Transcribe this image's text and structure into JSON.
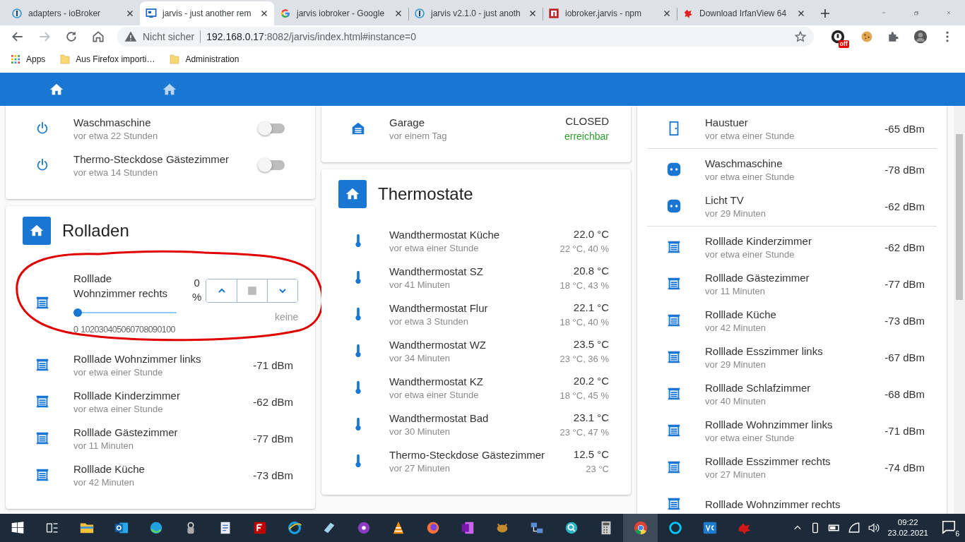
{
  "browser": {
    "tabs": [
      {
        "title": "adapters - ioBroker",
        "kind": "iobroker",
        "selected": false
      },
      {
        "title": "jarvis - just another rem",
        "kind": "jarvis",
        "selected": true
      },
      {
        "title": "jarvis iobroker - Google",
        "kind": "google",
        "selected": false
      },
      {
        "title": "jarvis v2.1.0 - just anoth",
        "kind": "iobroker",
        "selected": false
      },
      {
        "title": "iobroker.jarvis - npm",
        "kind": "npm",
        "selected": false
      },
      {
        "title": "Download IrfanView 64",
        "kind": "irfan",
        "selected": false
      }
    ],
    "security_label": "Nicht sicher",
    "url_host": "192.168.0.17",
    "url_rest": ":8082/jarvis/index.html#instance=0",
    "extension_badge": "off",
    "bookmarks": [
      {
        "kind": "apps",
        "label": "Apps"
      },
      {
        "kind": "folder",
        "label": "Aus Firefox importi…"
      },
      {
        "kind": "folder",
        "label": "Administration"
      }
    ]
  },
  "app_tabs": [
    {
      "selected": true
    },
    {
      "selected": false
    }
  ],
  "columns": [
    [
      {
        "rows": [
          {
            "kind": "power-switch",
            "name": "Waschmaschine",
            "time": "vor etwa 22 Stunden",
            "on": false
          },
          {
            "kind": "power-switch",
            "name": "Thermo-Steckdose Gästezimmer",
            "time": "vor etwa 14 Stunden",
            "on": false
          }
        ]
      },
      {
        "title": "Rolladen",
        "rows": [
          {
            "kind": "blind-control",
            "name": "Rolllade Wohnzimmer rechts",
            "level": 0,
            "reading": "0",
            "unit": "%",
            "status": "keine",
            "ticks": [
              "0",
              "10",
              "20",
              "30",
              "40",
              "50",
              "60",
              "70",
              "80",
              "90",
              "100"
            ]
          },
          {
            "kind": "blind",
            "name": "Rolllade Wohnzimmer links",
            "time": "vor etwa einer Stunde",
            "value": "-71 dBm"
          },
          {
            "kind": "blind",
            "name": "Rolllade Kinderzimmer",
            "time": "vor etwa einer Stunde",
            "value": "-62 dBm"
          },
          {
            "kind": "blind",
            "name": "Rolllade Gästezimmer",
            "time": "vor 11 Minuten",
            "value": "-77 dBm"
          },
          {
            "kind": "blind",
            "name": "Rolllade Küche",
            "time": "vor 42 Minuten",
            "value": "-73 dBm"
          }
        ]
      }
    ],
    [
      {
        "rows": [
          {
            "kind": "garage",
            "name": "Garage",
            "time": "vor einem Tag",
            "value": "CLOSED",
            "status": "erreichbar"
          }
        ]
      },
      {
        "title": "Thermostate",
        "rows": [
          {
            "kind": "thermostat",
            "name": "Wandthermostat Küche",
            "time": "vor etwa einer Stunde",
            "value": "22.0 °C",
            "detail": "22 °C, 40 %"
          },
          {
            "kind": "thermostat",
            "name": "Wandthermostat SZ",
            "time": "vor 41 Minuten",
            "value": "20.8 °C",
            "detail": "18 °C, 43 %"
          },
          {
            "kind": "thermostat",
            "name": "Wandthermostat Flur",
            "time": "vor etwa 3 Stunden",
            "value": "22.1 °C",
            "detail": "18 °C, 40 %"
          },
          {
            "kind": "thermostat",
            "name": "Wandthermostat WZ",
            "time": "vor 34 Minuten",
            "value": "23.5 °C",
            "detail": "23 °C, 36 %"
          },
          {
            "kind": "thermostat",
            "name": "Wandthermostat KZ",
            "time": "vor etwa einer Stunde",
            "value": "20.2 °C",
            "detail": "18 °C, 45 %"
          },
          {
            "kind": "thermostat",
            "name": "Wandthermostat Bad",
            "time": "vor 30 Minuten",
            "value": "23.1 °C",
            "detail": "23 °C, 47 %"
          },
          {
            "kind": "thermostat",
            "name": "Thermo-Steckdose Gästezimmer",
            "time": "vor 27 Minuten",
            "value": "12.5 °C",
            "detail": "23 °C"
          }
        ]
      }
    ],
    [
      {
        "rows": [
          {
            "kind": "door",
            "name": "Haustuer",
            "time": "vor etwa einer Stunde",
            "value": "-65 dBm"
          },
          {
            "kind": "divider"
          },
          {
            "kind": "socket",
            "name": "Waschmaschine",
            "time": "vor etwa einer Stunde",
            "value": "-78 dBm"
          },
          {
            "kind": "socket",
            "name": "Licht TV",
            "time": "vor 29 Minuten",
            "value": "-62 dBm"
          },
          {
            "kind": "divider"
          },
          {
            "kind": "blind",
            "name": "Rolllade Kinderzimmer",
            "time": "vor etwa einer Stunde",
            "value": "-62 dBm"
          },
          {
            "kind": "blind",
            "name": "Rolllade Gästezimmer",
            "time": "vor 11 Minuten",
            "value": "-77 dBm"
          },
          {
            "kind": "blind",
            "name": "Rolllade Küche",
            "time": "vor 42 Minuten",
            "value": "-73 dBm"
          },
          {
            "kind": "blind",
            "name": "Rolllade Esszimmer links",
            "time": "vor 29 Minuten",
            "value": "-67 dBm"
          },
          {
            "kind": "blind",
            "name": "Rolllade Schlafzimmer",
            "time": "vor 40 Minuten",
            "value": "-68 dBm"
          },
          {
            "kind": "blind",
            "name": "Rolllade Wohnzimmer links",
            "time": "vor etwa einer Stunde",
            "value": "-71 dBm"
          },
          {
            "kind": "blind",
            "name": "Rolllade Esszimmer rechts",
            "time": "vor 27 Minuten",
            "value": "-74 dBm"
          },
          {
            "kind": "blind",
            "name": "Rolllade Wohnzimmer rechts"
          }
        ]
      }
    ]
  ],
  "taskbar": {
    "apps": [
      {
        "selected": false
      },
      {
        "selected": false
      },
      {
        "selected": false
      },
      {
        "selected": false
      },
      {
        "selected": false
      },
      {
        "selected": false
      },
      {
        "selected": false
      },
      {
        "selected": false
      },
      {
        "selected": false
      },
      {
        "selected": false
      },
      {
        "selected": false
      },
      {
        "selected": false
      },
      {
        "selected": false
      },
      {
        "selected": false
      },
      {
        "selected": false
      },
      {
        "selected": false
      },
      {
        "selected": true
      },
      {
        "selected": false
      },
      {
        "selected": false
      },
      {
        "selected": false
      }
    ],
    "time": "09:22",
    "date": "23.02.2021",
    "notifications": "6"
  }
}
